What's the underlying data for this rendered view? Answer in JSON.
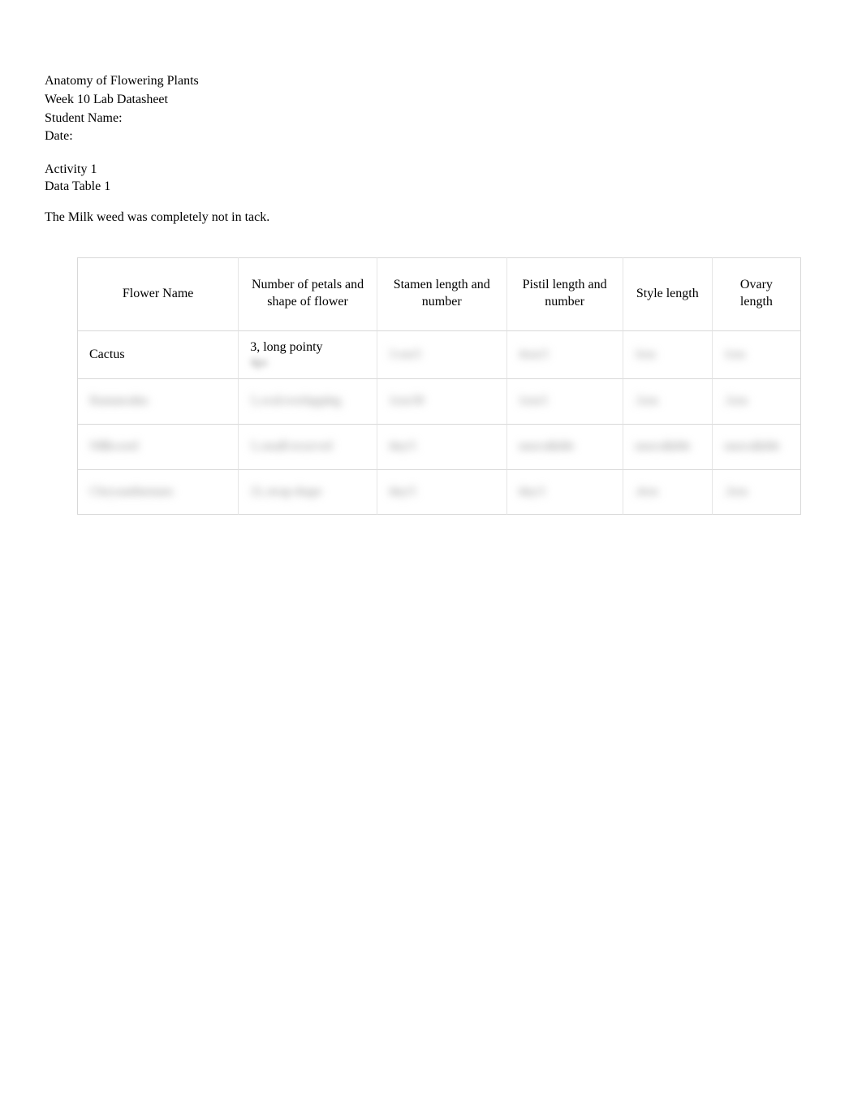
{
  "header": {
    "line1": "Anatomy of Flowering Plants",
    "line2": "Week 10 Lab Datasheet",
    "line3": "Student Name:",
    "line4": "Date:"
  },
  "activity": {
    "title": "Activity 1",
    "subtitle": "Data Table 1"
  },
  "note": "The Milk weed was completely not in tack.",
  "chart_data": {
    "type": "table",
    "columns": [
      "Flower Name",
      "Number of petals and shape of flower",
      "Stamen length and number",
      "Pistil length and number",
      "Style length",
      "Ovary length"
    ],
    "rows": [
      {
        "flower_name": "Cactus",
        "petals": "3, long pointy",
        "petals_blur": "tips",
        "stamen": "3 cm/3",
        "pistil": "4cm/3",
        "style": "3cm",
        "ovary": "1cm"
      },
      {
        "flower_name": "Ranunculus",
        "petals": "5, oval overlapping",
        "stamen": "1cm/30",
        "pistil": "1cm/1",
        "style": ".5cm",
        "ovary": ".5cm"
      },
      {
        "flower_name": "Milkweed",
        "petals": "5, small recurved",
        "stamen": "tiny/5",
        "pistil": "unavailable",
        "style": "unavailable",
        "ovary": "unavailable"
      },
      {
        "flower_name": "Chrysanthemum",
        "petals": "21, strap shape",
        "stamen": "tiny/5",
        "pistil": "tiny/1",
        "style": ".4cm",
        "ovary": ".3cm"
      }
    ]
  }
}
